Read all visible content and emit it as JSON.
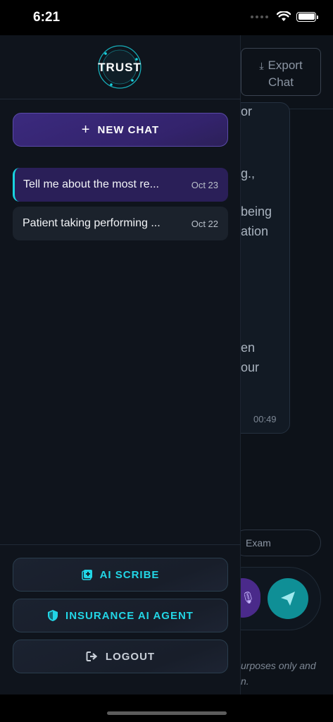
{
  "status_bar": {
    "time": "6:21"
  },
  "logo": {
    "text": "TRUST"
  },
  "drawer": {
    "new_chat_label": "NEW CHAT",
    "history": [
      {
        "title": "Tell me about the most re...",
        "date": "Oct 23",
        "active": true
      },
      {
        "title": "Patient taking performing ...",
        "date": "Oct 22",
        "active": false
      }
    ],
    "actions": {
      "ai_scribe": "AI SCRIBE",
      "insurance_agent": "INSURANCE AI AGENT",
      "logout": "LOGOUT"
    }
  },
  "background": {
    "export_label_1": "Export",
    "export_label_2": "Chat",
    "fragments": [
      "or",
      "g.,",
      "being",
      "ation",
      "en",
      "our"
    ],
    "message_time": "00:49",
    "chip_label": "Exam",
    "disclaimer_1": "urposes only and",
    "disclaimer_2": "n."
  },
  "colors": {
    "accent_cyan": "#19d3e0",
    "accent_purple": "#3b2a7e",
    "drawer_bg": "#0f141c"
  }
}
